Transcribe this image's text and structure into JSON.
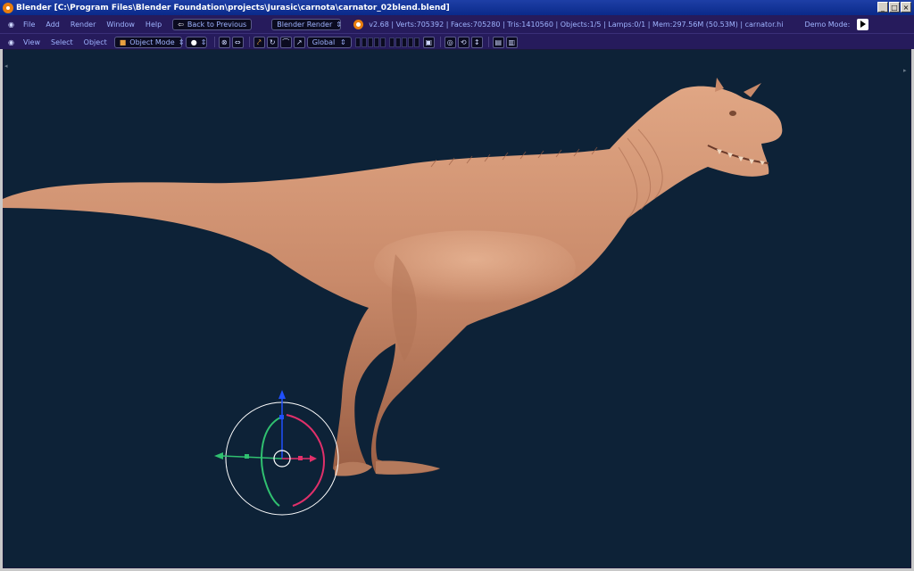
{
  "window": {
    "title": "Blender [C:\\Program Files\\Blender Foundation\\projects\\Jurasic\\carnota\\carnator_02blend.blend]",
    "minimize": "_",
    "maximize": "□",
    "close": "×"
  },
  "menu": {
    "items": [
      "File",
      "Add",
      "Render",
      "Window",
      "Help"
    ],
    "back_button": "Back to Previous",
    "engine": "Blender Render",
    "stats": "v2.68 | Verts:705392 | Faces:705280 | Tris:1410560 | Objects:1/5 | Lamps:0/1 | Mem:297.56M (50.53M) | carnator.hi",
    "demo_mode": "Demo Mode:"
  },
  "header3d": {
    "items": [
      "View",
      "Select",
      "Object"
    ],
    "mode": "Object Mode",
    "orientation": "Global"
  },
  "colors": {
    "title_bar": "#0a2a8a",
    "header_bg": "#261b5c",
    "viewport_bg": "#0d2237",
    "model": "#c98a6a",
    "gizmo_x": "#e0306a",
    "gizmo_y": "#30c070",
    "gizmo_z": "#2050ff"
  }
}
